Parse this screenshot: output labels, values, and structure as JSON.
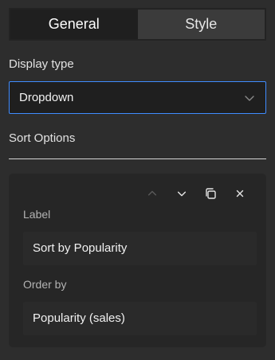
{
  "tabs": [
    {
      "label": "General",
      "active": true
    },
    {
      "label": "Style",
      "active": false
    }
  ],
  "display_type": {
    "label": "Display type",
    "selected": "Dropdown"
  },
  "sort_options": {
    "title": "Sort Options"
  },
  "sort_item": {
    "label_title": "Label",
    "label_value": "Sort by Popularity",
    "order_title": "Order by",
    "order_value": "Popularity (sales)",
    "icons": [
      "chevron-up-icon",
      "chevron-down-icon",
      "duplicate-icon",
      "close-icon"
    ]
  },
  "colors": {
    "panel_bg": "#2d2d2d",
    "active_tab_bg": "#1f1f1f",
    "select_border": "#3f8cff",
    "card_bg": "#262626"
  }
}
